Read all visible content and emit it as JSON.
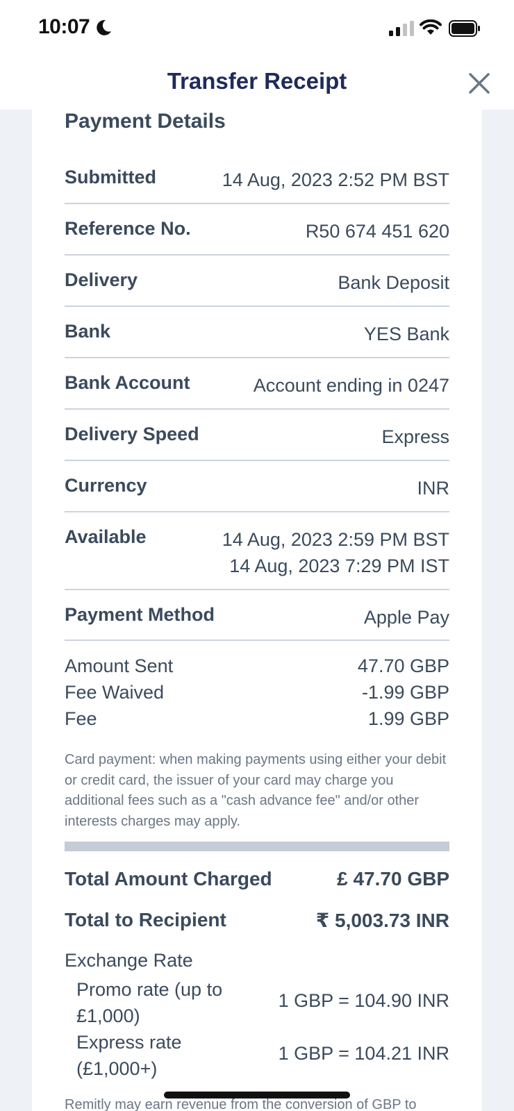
{
  "status_bar": {
    "time": "10:07"
  },
  "header": {
    "title": "Transfer Receipt"
  },
  "payment_details": {
    "title": "Payment Details",
    "rows": [
      {
        "label": "Submitted",
        "value": "14 Aug, 2023 2:52 PM BST"
      },
      {
        "label": "Reference No.",
        "value": "R50 674 451 620"
      },
      {
        "label": "Delivery",
        "value": "Bank Deposit"
      },
      {
        "label": "Bank",
        "value": "YES Bank"
      },
      {
        "label": "Bank Account",
        "value": "Account ending in 0247"
      },
      {
        "label": "Delivery Speed",
        "value": "Express"
      },
      {
        "label": "Currency",
        "value": "INR"
      },
      {
        "label": "Available",
        "value": "14 Aug, 2023 2:59 PM BST",
        "value2": "14 Aug, 2023 7:29 PM IST"
      },
      {
        "label": "Payment Method",
        "value": "Apple Pay"
      }
    ]
  },
  "amounts": [
    {
      "label": "Amount Sent",
      "value": "47.70 GBP"
    },
    {
      "label": "Fee Waived",
      "value": "-1.99 GBP"
    },
    {
      "label": "Fee",
      "value": "1.99 GBP"
    }
  ],
  "card_note": "Card payment: when making payments using either your debit or credit card, the issuer of your card may charge you additional fees such as a \"cash advance fee\" and/or other interests charges may apply.",
  "totals": {
    "charged_label": "Total Amount Charged",
    "charged_value": "£ 47.70 GBP",
    "recipient_label": "Total to Recipient",
    "recipient_value": "₹ 5,003.73 INR"
  },
  "exchange": {
    "title": "Exchange Rate",
    "rates": [
      {
        "label": "Promo rate (up to £1,000)",
        "value": "1 GBP = 104.90 INR"
      },
      {
        "label": "Express rate (£1,000+)",
        "value": "1 GBP = 104.21 INR"
      }
    ]
  },
  "footer_text": "Remitly may earn revenue from the conversion of GBP to"
}
